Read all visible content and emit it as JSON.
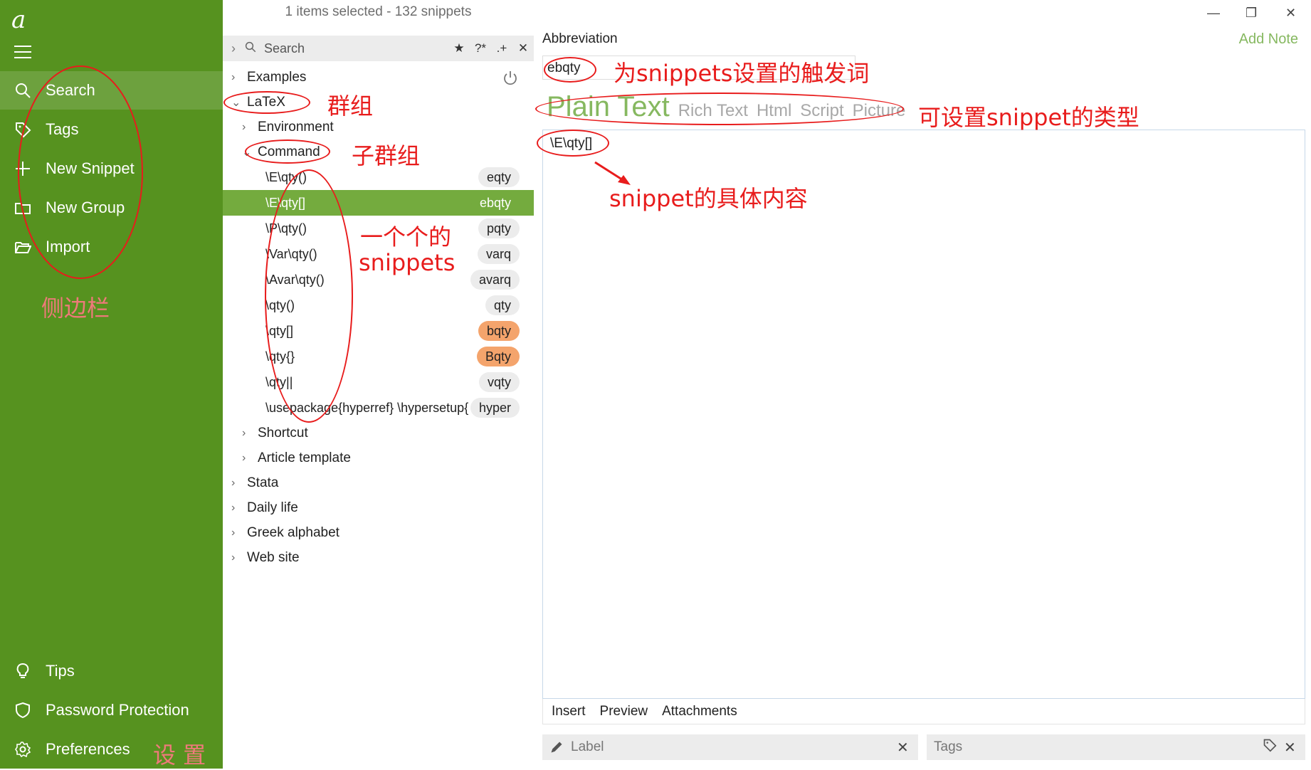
{
  "sidebar": {
    "logo": "a",
    "top_items": [
      {
        "label": "Search",
        "icon": "search-icon"
      },
      {
        "label": "Tags",
        "icon": "tag-icon"
      },
      {
        "label": "New Snippet",
        "icon": "plus-icon"
      },
      {
        "label": "New Group",
        "icon": "folder-icon"
      },
      {
        "label": "Import",
        "icon": "folder-open-icon"
      }
    ],
    "bottom_items": [
      {
        "label": "Tips",
        "icon": "lightbulb-icon"
      },
      {
        "label": "Password Protection",
        "icon": "shield-icon"
      },
      {
        "label": "Preferences",
        "icon": "gear-icon"
      }
    ]
  },
  "list": {
    "selection_info": "1 items selected - 132 snippets",
    "search_placeholder": "Search",
    "search_tools": [
      "★",
      "?*",
      ".+",
      "✕"
    ],
    "groups_top": [
      {
        "label": "Examples"
      },
      {
        "label": "LaTeX"
      }
    ],
    "subgroups": [
      {
        "label": "Environment"
      },
      {
        "label": "Command"
      }
    ],
    "snippets": [
      {
        "content": "\\E\\qty()",
        "abbr": "eqty",
        "active": false,
        "highlight": false
      },
      {
        "content": "\\E\\qty[]",
        "abbr": "ebqty",
        "active": true,
        "highlight": false
      },
      {
        "content": "\\P\\qty()",
        "abbr": "pqty",
        "active": false,
        "highlight": false
      },
      {
        "content": "\\Var\\qty()",
        "abbr": "varq",
        "active": false,
        "highlight": false
      },
      {
        "content": "\\Avar\\qty()",
        "abbr": "avarq",
        "active": false,
        "highlight": false
      },
      {
        "content": "\\qty()",
        "abbr": "qty",
        "active": false,
        "highlight": false
      },
      {
        "content": "\\qty[]",
        "abbr": "bqty",
        "active": false,
        "highlight": true
      },
      {
        "content": "\\qty{}",
        "abbr": "Bqty",
        "active": false,
        "highlight": true
      },
      {
        "content": "\\qty||",
        "abbr": "vqty",
        "active": false,
        "highlight": false
      },
      {
        "content": "\\usepackage{hyperref} \\hypersetup{",
        "abbr": "hyper",
        "active": false,
        "highlight": false
      }
    ],
    "subgroups_after": [
      {
        "label": "Shortcut"
      },
      {
        "label": "Article template"
      }
    ],
    "groups_bottom": [
      {
        "label": "Stata"
      },
      {
        "label": "Daily life"
      },
      {
        "label": "Greek alphabet"
      },
      {
        "label": "Web site"
      }
    ]
  },
  "editor": {
    "abbreviation_label": "Abbreviation",
    "add_note": "Add Note",
    "abbreviation_value": "ebqty",
    "types": [
      "Plain Text",
      "Rich Text",
      "Html",
      "Script",
      "Picture"
    ],
    "active_type": "Plain Text",
    "content": "\\E\\qty[]",
    "tabs": [
      "Insert",
      "Preview",
      "Attachments"
    ],
    "label_placeholder": "Label",
    "tags_placeholder": "Tags",
    "window_controls": [
      "—",
      "❐",
      "✕"
    ]
  },
  "annotations": {
    "sidebar": "侧边栏",
    "settings": "设 置",
    "group": "群组",
    "subgroup": "子群组",
    "snippets_line1": "一个个的",
    "snippets_line2": "snippets",
    "trigger": "为snippets设置的触发词",
    "type": "可设置snippet的类型",
    "content": "snippet的具体内容"
  },
  "colors": {
    "sidebar_bg": "#56921f",
    "accent_green": "#74ab3e",
    "badge_orange": "#f4a46c",
    "annotation_red": "#e81c1c"
  }
}
